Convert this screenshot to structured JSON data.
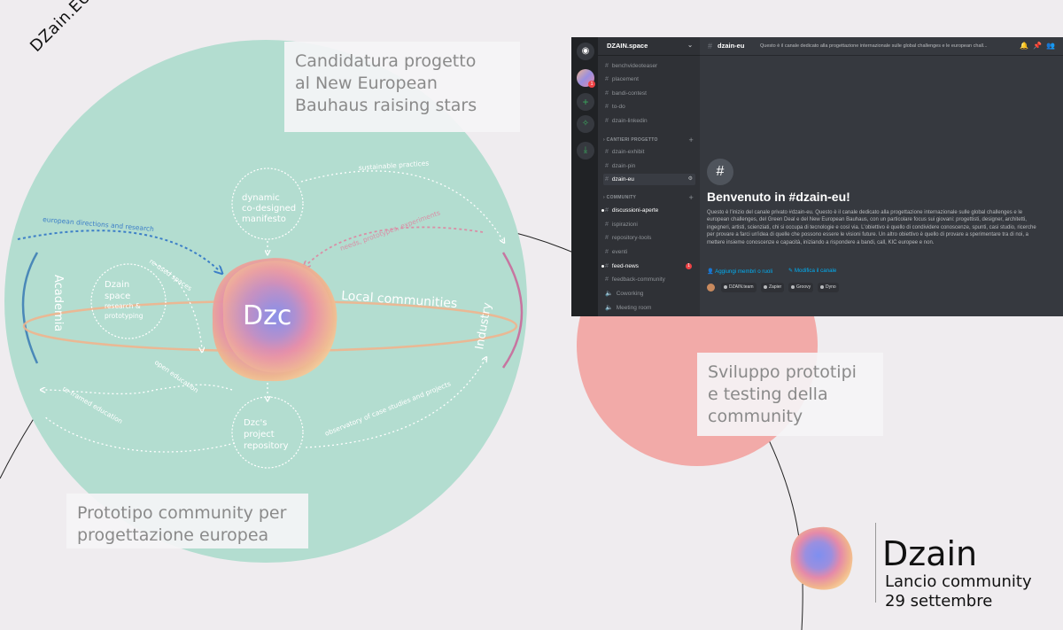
{
  "brand": "DZain.EU",
  "callouts": {
    "candidatura": [
      "Candidatura progetto",
      "al New European",
      "Bauhaus raising stars"
    ],
    "prototipo": [
      "Prototipo community per",
      "progettazione europea"
    ],
    "sviluppo": [
      "Sviluppo prototipi",
      "e testing della",
      "community"
    ]
  },
  "diagram": {
    "center": "Dzc",
    "local_communities": "Local communities",
    "academia": "Academia",
    "industry": "Industry",
    "manifesto": [
      "dynamic",
      "co-designed",
      "manifesto"
    ],
    "space": [
      "Dzain",
      "space",
      "research &",
      "prototyping"
    ],
    "repository": [
      "Dzc's",
      "project",
      "repository"
    ],
    "arrows": {
      "sustainable": "sustainable practices",
      "european": "european directions and research",
      "needs": "needs, prototypes, experiments",
      "reused": "re-used spaces",
      "open": "open education",
      "reframed": "re-framed education",
      "observatory": "observatory of case studies and projects"
    }
  },
  "discord": {
    "server_name": "DZAIN.space",
    "channels_top": [
      "benchvideoteaser",
      "placement",
      "bandi-contest",
      "to-do",
      "dzain-linkedin"
    ],
    "category1": "CANTIERI PROGETTO",
    "channels_cantieri": [
      "dzain-exhibit",
      "dzain-pin",
      "dzain-eu"
    ],
    "category2": "COMMUNITY",
    "channels_community": [
      {
        "name": "discussioni-aperte",
        "unread": true
      },
      {
        "name": "ispirazioni",
        "unread": false
      },
      {
        "name": "repository-tools",
        "unread": false
      },
      {
        "name": "eventi",
        "unread": false
      },
      {
        "name": "feed-news",
        "unread": true,
        "badge": "1"
      },
      {
        "name": "feedback-community",
        "unread": false
      }
    ],
    "voice_channels": [
      "Coworking",
      "Meeting room"
    ],
    "server_badge": "1",
    "topbar": {
      "channel": "dzain-eu",
      "topic": "Questo è il canale dedicato alla progettazione internazionale sulle global challenges e le european chall..."
    },
    "welcome_title": "Benvenuto in #dzain-eu!",
    "welcome_desc": "Questo è l'inizio del canale privato #dzain-eu. Questo è il canale dedicato alla progettazione internazionale sulle global challenges e le european challenges, del Green Deal e del New European Bauhaus, con un particolare focus sui giovani: progettisti, designer, architetti, ingegneri, artisti, scienziati, chi si occupa di tecnologie e così via. L'obiettivo è quello di condividere conoscenze, spunti, casi studio, ricerche per provare a farci un'idea di quelle che possono essere le visioni future. Un altro obiettivo è quello di provare a sperimentare tra di noi, a mettere insieme conoscenze e capacità, iniziando a rispondere a bandi, call, KIC europee e non.",
    "add_members": "Aggiungi membri o ruoli",
    "edit_channel": "Modifica il canale",
    "bots": [
      "DZAIN.team",
      "Zapier",
      "Groovy",
      "Dyno"
    ]
  },
  "logo": {
    "name": "Dzain",
    "line1": "Lancio community",
    "line2": "29 settembre"
  }
}
